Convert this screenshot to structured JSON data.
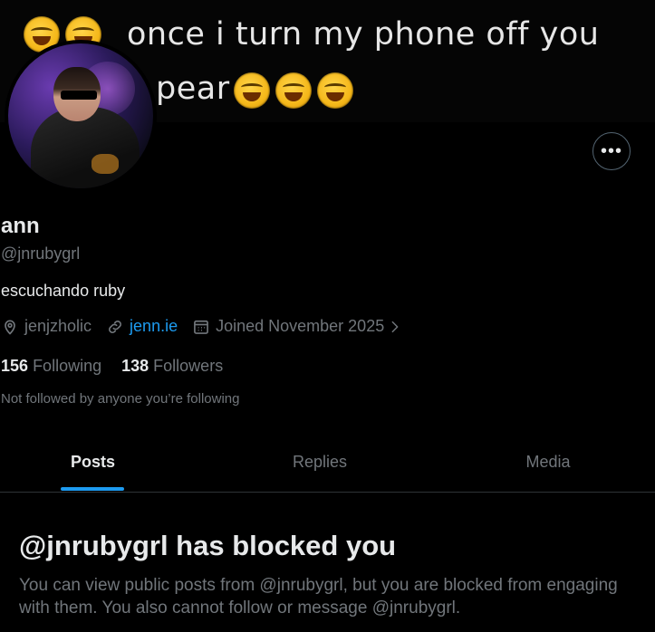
{
  "banner": {
    "line1": "once i turn my phone off you",
    "line2": "pear",
    "emoji_name": "face-with-tears-of-joy"
  },
  "profile": {
    "name": "ann",
    "handle": "@jnrubygrl",
    "bio": "escuchando ruby",
    "location": "jenjzholic",
    "website": "jenn.ie",
    "joined": "Joined November 2025",
    "following_count": "156",
    "following_label": "Following",
    "followers_count": "138",
    "followers_label": "Followers",
    "not_followed_text": "Not followed by anyone you’re following",
    "more_label": "•••"
  },
  "tabs": [
    {
      "label": "Posts",
      "active": true
    },
    {
      "label": "Replies",
      "active": false
    },
    {
      "label": "Media",
      "active": false
    }
  ],
  "blocked": {
    "title": "@jnrubygrl has blocked you",
    "message": "You can view public posts from @jnrubygrl, but you are blocked from engaging with them. You also cannot follow or message @jnrubygrl."
  },
  "colors": {
    "background": "#000000",
    "text_primary": "#e7e9ea",
    "text_secondary": "#71767b",
    "accent": "#1d9bf0",
    "divider": "#2f3336"
  }
}
